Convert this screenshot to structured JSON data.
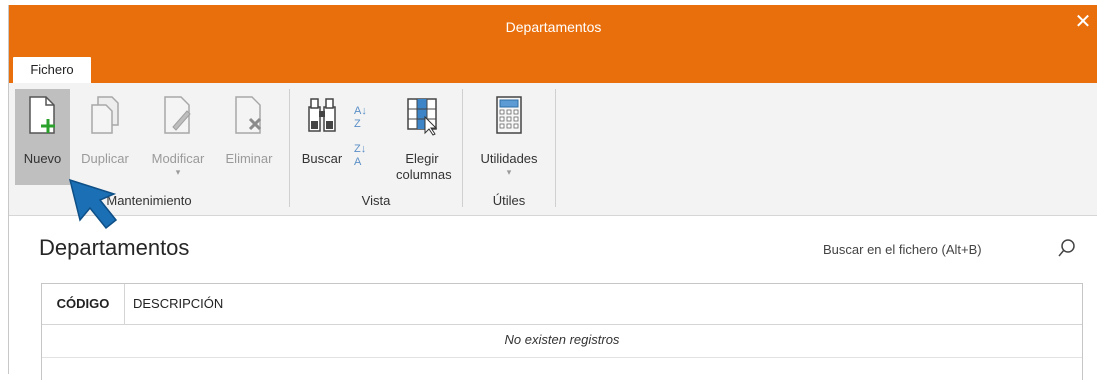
{
  "window": {
    "title": "Departamentos",
    "close_glyph": "✕"
  },
  "tabs": [
    {
      "label": "Fichero",
      "active": true
    }
  ],
  "ribbon": {
    "groups": [
      {
        "label": "Mantenimiento",
        "buttons": [
          {
            "label": "Nuevo",
            "icon": "new-document-icon",
            "enabled": true
          },
          {
            "label": "Duplicar",
            "icon": "duplicate-icon",
            "enabled": false
          },
          {
            "label": "Modificar",
            "icon": "edit-document-icon",
            "enabled": false,
            "dropdown": true
          },
          {
            "label": "Eliminar",
            "icon": "delete-document-icon",
            "enabled": false
          }
        ]
      },
      {
        "label": "Vista",
        "buttons": [
          {
            "label": "Buscar",
            "icon": "binoculars-icon",
            "enabled": true
          },
          {
            "label": "Elegir columnas",
            "icon": "choose-columns-icon",
            "enabled": true
          }
        ],
        "sort_glyphs": {
          "asc": "A↓",
          "asc_top": "Z",
          "desc": "Z↓",
          "desc_bottom": "A"
        }
      },
      {
        "label": "Útiles",
        "buttons": [
          {
            "label": "Utilidades",
            "icon": "calculator-icon",
            "enabled": true,
            "dropdown": true
          }
        ]
      }
    ],
    "dropdown_glyph": "▾"
  },
  "content": {
    "title": "Departamentos",
    "search": {
      "placeholder": "Buscar en el fichero (Alt+B)",
      "icon": "search-icon"
    }
  },
  "table": {
    "columns": [
      "CÓDIGO",
      "DESCRIPCIÓN"
    ],
    "empty_message": "No existen registros"
  },
  "colors": {
    "accent": "#e96f0c",
    "ribbon_bg": "#f3f3f3",
    "cursor": "#1a6fb5"
  }
}
